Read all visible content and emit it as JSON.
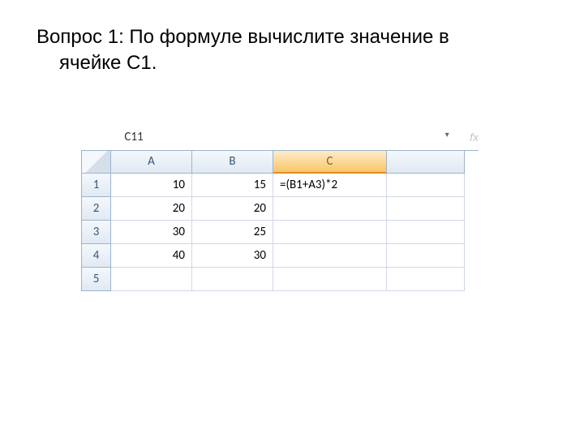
{
  "question": {
    "line1": "Вопрос 1: По формуле вычислите значение в",
    "line2": "ячейке C1."
  },
  "namebox": "C11",
  "fx": "fx",
  "headers": {
    "A": "A",
    "B": "B",
    "C": "C"
  },
  "rows": {
    "r1": "1",
    "r2": "2",
    "r3": "3",
    "r4": "4",
    "r5": "5"
  },
  "cells": {
    "A1": "10",
    "B1": "15",
    "C1": "=(B1+A3)*2",
    "A2": "20",
    "B2": "20",
    "A3": "30",
    "B3": "25",
    "A4": "40",
    "B4": "30"
  }
}
